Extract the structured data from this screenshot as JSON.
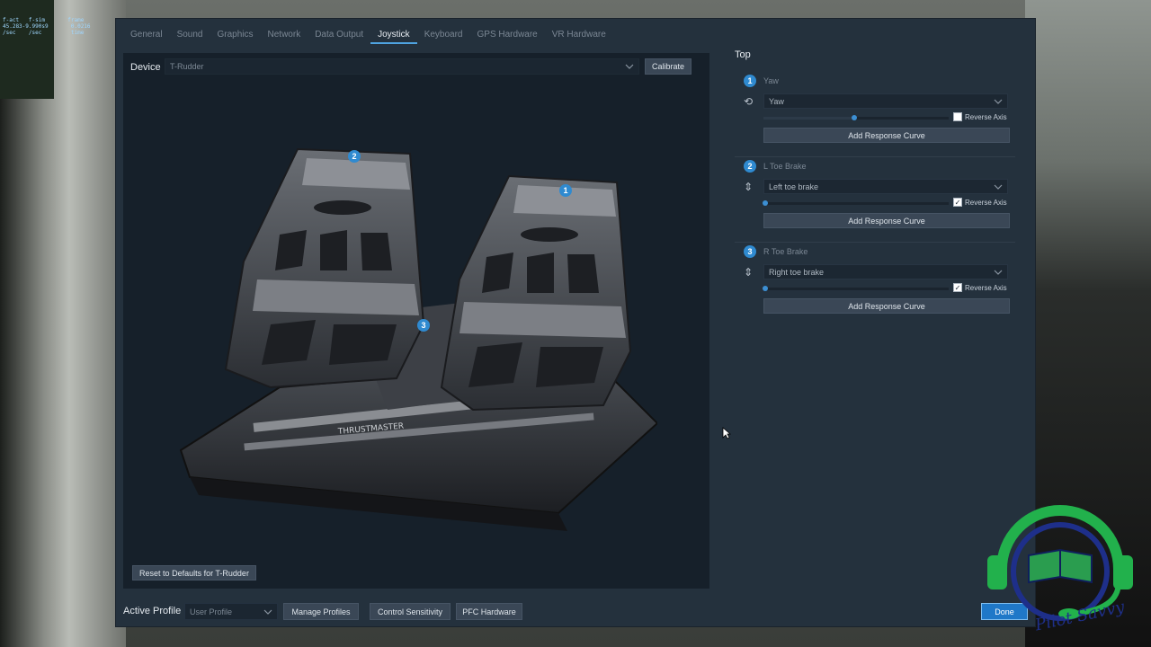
{
  "debug": {
    "text": "f-act   f-sim       frame\n45.283-9.990s9       0.0216\n/sec    /sec         time"
  },
  "tabs": [
    {
      "label": "General",
      "active": false
    },
    {
      "label": "Sound",
      "active": false
    },
    {
      "label": "Graphics",
      "active": false
    },
    {
      "label": "Network",
      "active": false
    },
    {
      "label": "Data Output",
      "active": false
    },
    {
      "label": "Joystick",
      "active": true
    },
    {
      "label": "Keyboard",
      "active": false
    },
    {
      "label": "GPS Hardware",
      "active": false
    },
    {
      "label": "VR Hardware",
      "active": false
    }
  ],
  "device": {
    "label": "Device",
    "selected": "T-Rudder",
    "calibrate_label": "Calibrate",
    "reset_label": "Reset to Defaults for T-Rudder",
    "pedal_brand": "THRUSTMASTER",
    "badges": [
      "1",
      "2",
      "3"
    ]
  },
  "axes": {
    "section_title": "Top",
    "reverse_label": "Reverse Axis",
    "add_curve_label": "Add Response Curve",
    "items": [
      {
        "num": "1",
        "title": "Yaw",
        "assignment": "Yaw",
        "value": 0.5,
        "reverse": false,
        "icon": "rotate-icon"
      },
      {
        "num": "2",
        "title": "L Toe Brake",
        "assignment": "Left toe brake",
        "value": 0.0,
        "reverse": true,
        "icon": "up-down-icon"
      },
      {
        "num": "3",
        "title": "R Toe Brake",
        "assignment": "Right toe brake",
        "value": 0.0,
        "reverse": true,
        "icon": "up-down-icon"
      }
    ]
  },
  "bottom": {
    "active_profile_label": "Active Profile",
    "profile_value": "User Profile",
    "manage_label": "Manage Profiles",
    "sensitivity_label": "Control Sensitivity",
    "pfc_label": "PFC Hardware",
    "done_label": "Done"
  },
  "watermark": {
    "text": "Pilot Savvy"
  },
  "colors": {
    "accent": "#2f8ad0",
    "window_bg": "#24313d",
    "panel_bg": "#16202a",
    "logo_green": "#22b14c",
    "logo_blue": "#1e2f8a"
  }
}
